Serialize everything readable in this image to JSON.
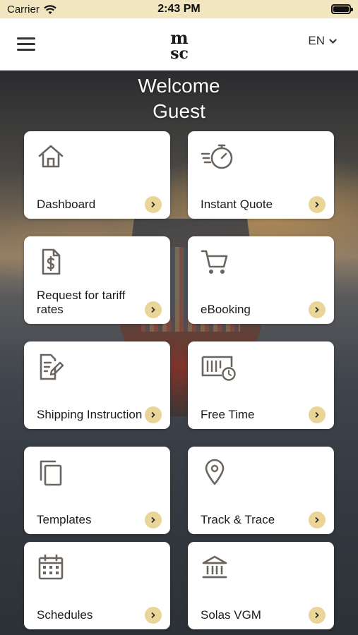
{
  "status_bar": {
    "carrier": "Carrier",
    "time": "2:43 PM"
  },
  "header": {
    "logo_text_top": "m",
    "logo_text_bottom": "sc",
    "language": "EN"
  },
  "welcome": {
    "line1": "Welcome",
    "line2": "Guest"
  },
  "tiles": [
    {
      "label": "Dashboard",
      "icon": "home-icon"
    },
    {
      "label": "Instant Quote",
      "icon": "stopwatch-icon"
    },
    {
      "label": "Request for tariff rates",
      "icon": "dollar-document-icon"
    },
    {
      "label": "eBooking",
      "icon": "cart-icon"
    },
    {
      "label": "Shipping Instruction",
      "icon": "edit-document-icon"
    },
    {
      "label": "Free Time",
      "icon": "container-clock-icon"
    },
    {
      "label": "Templates",
      "icon": "copy-icon"
    },
    {
      "label": "Track & Trace",
      "icon": "location-pin-icon"
    },
    {
      "label": "Schedules",
      "icon": "calendar-icon"
    },
    {
      "label": "Solas VGM",
      "icon": "bank-icon"
    }
  ],
  "colors": {
    "accent": "#e9d598",
    "status_bar_bg": "#f1e6c0",
    "icon": "#6b6560"
  }
}
